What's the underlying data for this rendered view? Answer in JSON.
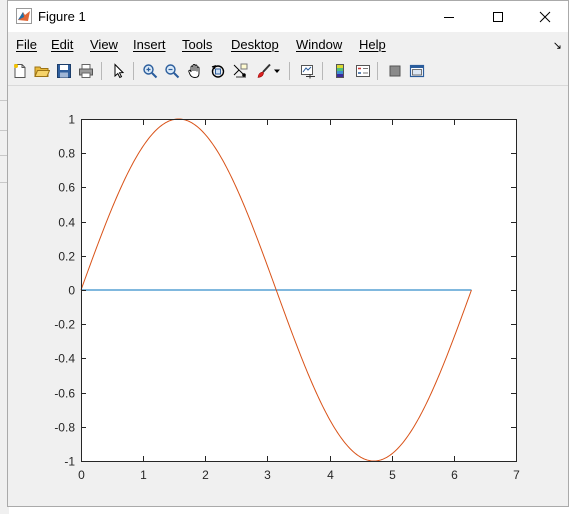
{
  "window": {
    "title": "Figure 1"
  },
  "menu": [
    "File",
    "Edit",
    "View",
    "Insert",
    "Tools",
    "Desktop",
    "Window",
    "Help"
  ],
  "toolbar_icons": [
    "new-figure-icon",
    "open-file-icon",
    "save-icon",
    "print-icon",
    "select-arrow-icon",
    "zoom-in-icon",
    "zoom-out-icon",
    "pan-hand-icon",
    "rotate-3d-icon",
    "data-cursor-icon",
    "brush-icon",
    "dropdown-arrow-icon",
    "link-plot-icon",
    "colorbar-icon",
    "legend-icon",
    "hide-plot-tools-icon",
    "show-plot-tools-icon"
  ],
  "colors": {
    "sine_series": "#d95319",
    "zero_series": "#0072bd",
    "axes": "#262626"
  },
  "chart_data": {
    "type": "line",
    "title": "",
    "xlabel": "",
    "ylabel": "",
    "xlim": [
      0,
      7
    ],
    "ylim": [
      -1,
      1
    ],
    "x_ticks": [
      "0",
      "1",
      "2",
      "3",
      "4",
      "5",
      "6",
      "7"
    ],
    "y_ticks": [
      "-1",
      "-0.8",
      "-0.6",
      "-0.4",
      "-0.2",
      "0",
      "0.2",
      "0.4",
      "0.6",
      "0.8",
      "1"
    ],
    "grid": false,
    "series": [
      {
        "function": "y = 0",
        "x_range": [
          0,
          6.2832
        ],
        "color": "#0072bd"
      },
      {
        "function": "y = sin(x)",
        "x_range": [
          0,
          6.2832
        ],
        "color": "#d95319"
      }
    ]
  }
}
